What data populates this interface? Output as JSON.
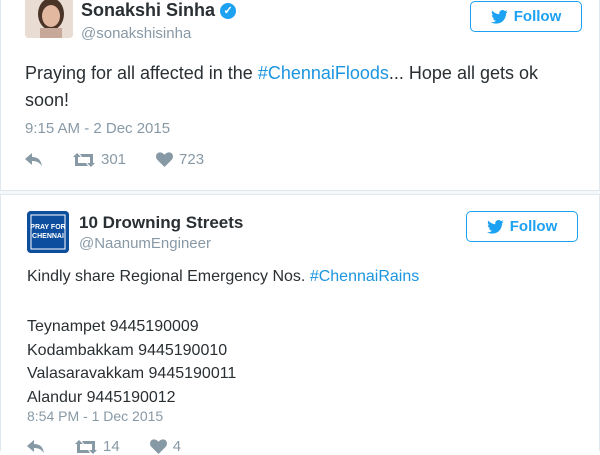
{
  "tweet1": {
    "name": "Sonakshi Sinha",
    "handle": "@sonakshisinha",
    "follow_label": "Follow",
    "text_before": "Praying for all affected in the ",
    "hashtag": "#ChennaiFloods",
    "text_after": "... Hope all gets ok soon!",
    "timestamp": "9:15 AM - 2 Dec 2015",
    "retweets": "301",
    "likes": "723",
    "icons": [
      "reply-icon",
      "retweet-icon",
      "heart-icon",
      "bird-icon",
      "verified-badge-icon"
    ]
  },
  "tweet2": {
    "name": "10 Drowning Streets",
    "handle": "@NaanumEngineer",
    "avatar_text": "PRAY FOR CHENNAI",
    "follow_label": "Follow",
    "text_before": "Kindly share Regional Emergency Nos. ",
    "hashtag": "#ChennaiRains",
    "lines": [
      "Teynampet 9445190009",
      "Kodambakkam 9445190010",
      "Valasaravakkam 9445190011",
      "Alandur 9445190012"
    ],
    "timestamp": "8:54 PM - 1 Dec 2015",
    "retweets": "14",
    "likes": "4"
  },
  "colors": {
    "accent": "#1da1f2",
    "hashtag": "#1b95e0",
    "muted": "#8899a6",
    "text": "#292f33",
    "border": "#e1e8ed"
  }
}
